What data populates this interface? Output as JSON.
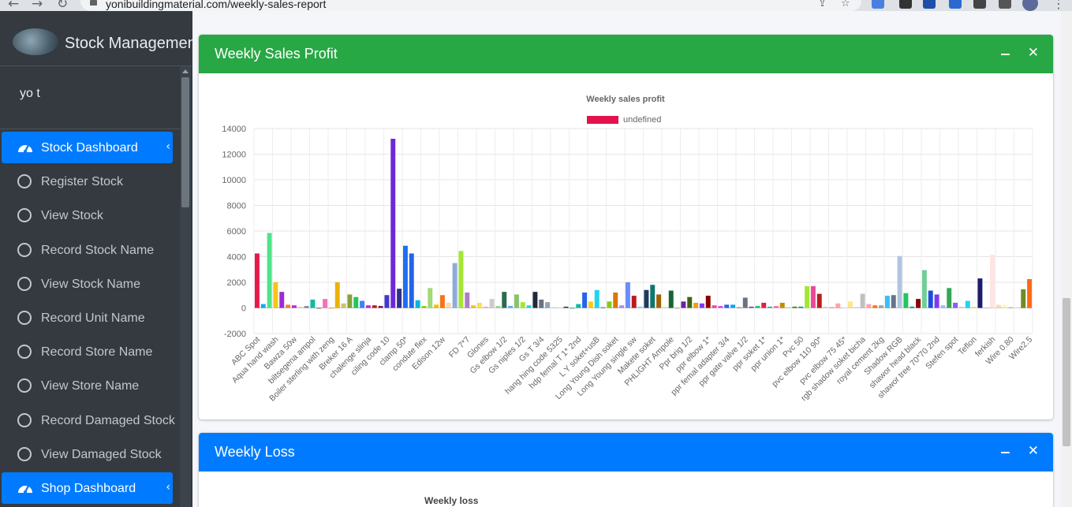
{
  "browser": {
    "url": "yonibuildingmaterial.com/weekly-sales-report"
  },
  "sidebar": {
    "brand": "Stock Management",
    "user": "yo t",
    "items": [
      {
        "label": "Stock Dashboard",
        "active": true,
        "icon": "tachometer-icon"
      },
      {
        "label": "Register Stock",
        "active": false,
        "icon": "circle-icon"
      },
      {
        "label": "View Stock",
        "active": false,
        "icon": "circle-icon"
      },
      {
        "label": "Record Stock Name",
        "active": false,
        "icon": "circle-icon"
      },
      {
        "label": "View Stock Name",
        "active": false,
        "icon": "circle-icon"
      },
      {
        "label": "Record Unit Name",
        "active": false,
        "icon": "circle-icon"
      },
      {
        "label": "Record Store Name",
        "active": false,
        "icon": "circle-icon"
      },
      {
        "label": "View Store Name",
        "active": false,
        "icon": "circle-icon"
      },
      {
        "label": "Record Damaged Stock",
        "active": false,
        "icon": "circle-icon"
      },
      {
        "label": "View Damaged Stock",
        "active": false,
        "icon": "circle-icon"
      },
      {
        "label": "Shop Dashboard",
        "active": true,
        "icon": "tachometer-icon"
      }
    ]
  },
  "cards": {
    "profit": {
      "title": "Weekly Sales Profit",
      "color": "#28a745"
    },
    "loss": {
      "title": "Weekly Loss",
      "color": "#007bff",
      "chart_title": "Weekly loss"
    }
  },
  "chart_data": {
    "type": "bar",
    "title": "Weekly sales profit",
    "legend": {
      "label": "undefined",
      "color": "#e3124d",
      "position": "top"
    },
    "ylim": [
      -2000,
      14000
    ],
    "yticks": [
      -2000,
      0,
      2000,
      4000,
      6000,
      8000,
      10000,
      12000,
      14000
    ],
    "grid": true,
    "tick_labels": [
      "ABC Spot",
      "Aqua hand wash",
      "Bawza 50w",
      "biltsegena ampol",
      "Boiler sterling with zeng",
      "Breker 16 A",
      "chalenge slinja",
      "ciling code 10",
      "clamp 50*",
      "condute flex",
      "Edison 12w",
      "FD 7*7",
      "Glones",
      "Gs elbow 1/2",
      "Gs niples 1/2",
      "Gs T 3/4",
      "hang hing code 5325",
      "hdp femal T 1* 2nd",
      "L Y soket+usB",
      "Long Young Dish soket",
      "Long Young single sw",
      "Makete soket",
      "PHLIGHT Ampole",
      "Ppr brig 1/2",
      "ppr elbow 1*",
      "ppr femal adapter 3/4",
      "ppr gate valve 1/2",
      "ppr soket 1*",
      "ppr union 1*",
      "Pvc 50",
      "pvc elbow 110 90*",
      "pvc elbow 75 45*",
      "rgb shadow soket bicha",
      "royal cement 2kg",
      "Shadow RGB",
      "shawor head black",
      "shawor tree 70*70 2nd",
      "Stefen spot",
      "Teflon",
      "ferkish",
      "Wire 0.80",
      "Wire2.5"
    ],
    "values": [
      4250,
      300,
      5850,
      2000,
      1250,
      250,
      200,
      100,
      150,
      650,
      0,
      700,
      -50,
      2000,
      350,
      1050,
      850,
      550,
      200,
      200,
      150,
      1000,
      13200,
      1500,
      4850,
      4250,
      600,
      150,
      1550,
      250,
      1000,
      400,
      3500,
      4450,
      1200,
      200,
      400,
      100,
      700,
      150,
      1250,
      150,
      1050,
      450,
      200,
      1250,
      650,
      450,
      50,
      0,
      100,
      0,
      300,
      1200,
      500,
      1400,
      50,
      500,
      1200,
      200,
      2000,
      950,
      100,
      1400,
      1800,
      1050,
      100,
      1350,
      0,
      500,
      850,
      400,
      350,
      950,
      200,
      150,
      250,
      250,
      50,
      800,
      100,
      150,
      400,
      100,
      150,
      400,
      50,
      100,
      100,
      1700,
      1700,
      1100,
      100,
      50,
      350,
      0,
      500,
      100,
      1100,
      300,
      200,
      200,
      950,
      1000,
      4050,
      1150,
      100,
      700,
      2950,
      1350,
      1050,
      200,
      1550,
      400,
      100,
      550,
      100,
      2300,
      0,
      4150,
      250,
      250,
      50,
      50,
      1450,
      2250
    ],
    "colors": [
      "#e6194b",
      "#1ca3ec",
      "#4ee58a",
      "#f5c518",
      "#9b2bd8",
      "#f58231",
      "#c026d3",
      "#d1d5db",
      "#8b8b8b",
      "#14b8a6",
      "#444444",
      "#f472b6",
      "#f59e0b",
      "#eab308",
      "#d0c36a",
      "#84a33b",
      "#22c55e",
      "#3b82f6",
      "#c026d3",
      "#b91c1c",
      "#6b1d5e",
      "#4338ca",
      "#6d28d9",
      "#2f2f8f",
      "#1e6ef0",
      "#2563eb",
      "#06b6d4",
      "#84cc16",
      "#a3d977",
      "#f0c000",
      "#f97316",
      "#fed7aa",
      "#8faadc",
      "#a3e635",
      "#b07cc6",
      "#fbbf24",
      "#fde047",
      "#f9a8d4",
      "#cccccc",
      "#94d3a2",
      "#2d6a4f",
      "#60a5fa",
      "#86c56b",
      "#a3e635",
      "#22d3ee",
      "#1e293b",
      "#6b7280",
      "#94a3b8",
      "#cbd5e1",
      "#e2e8f0",
      "#374151",
      "#16a34a",
      "#14b8a6",
      "#2563eb",
      "#facc15",
      "#22d3ee",
      "#2d6a4f",
      "#84cc16",
      "#d97706",
      "#a78bfa",
      "#6b8cff",
      "#b91c1c",
      "#7dd3fc",
      "#1e3a5f",
      "#0f766e",
      "#a16207",
      "#d9f99d",
      "#166534",
      "#9ca3af",
      "#6b21a8",
      "#3f6212",
      "#f59e0b",
      "#7c3aed",
      "#8b0000",
      "#ec4899",
      "#d946ef",
      "#2563eb",
      "#0ea5e9",
      "#b45309",
      "#6b7280",
      "#7c3aed",
      "#22c55e",
      "#e11d48",
      "#14b8a6",
      "#f472b6",
      "#ca8a04",
      "#86efac",
      "#4d7c0f",
      "#0d9488",
      "#a3e635",
      "#ec4899",
      "#b91c1c",
      "#d1d5db",
      "#f87171",
      "#fca5a5",
      "#e5e7eb",
      "#fde68a",
      "#e2e8f0",
      "#c0c0c0",
      "#fda4af",
      "#f97316",
      "#9ca3af",
      "#38bdf8",
      "#64748b",
      "#b0c4de",
      "#22c55e",
      "#0d9488",
      "#8b0000",
      "#6fcf97",
      "#1d4ed8",
      "#7c3aed",
      "#a5b4fc",
      "#34a853",
      "#8b5cf6",
      "#d1d5db",
      "#22d3ee",
      "#fde68a",
      "#1e1b6e",
      "#cbd5e1",
      "#ffe4e1",
      "#f5deb3",
      "#fef3c7",
      "#a3a3a3",
      "#e5e7eb",
      "#6b8e23",
      "#ff6a13"
    ]
  }
}
